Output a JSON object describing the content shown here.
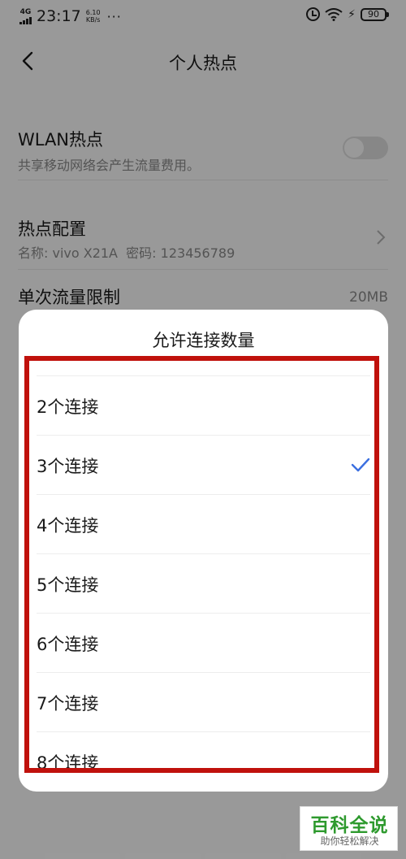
{
  "status_bar": {
    "network": "4G",
    "time": "23:17",
    "speed_value": "6.10",
    "speed_unit": "KB/s",
    "more": "···",
    "battery": "90"
  },
  "nav": {
    "title": "个人热点"
  },
  "settings": {
    "wlan_hotspot": {
      "title": "WLAN热点",
      "subtitle": "共享移动网络会产生流量费用。",
      "enabled": false
    },
    "hotspot_config": {
      "title": "热点配置",
      "subtitle": "名称: vivo X21A  密码: 123456789"
    },
    "data_limit": {
      "title": "单次流量限制",
      "value": "20MB"
    }
  },
  "dialog": {
    "title": "允许连接数量",
    "options": [
      {
        "label": "2个连接",
        "selected": false
      },
      {
        "label": "3个连接",
        "selected": true
      },
      {
        "label": "4个连接",
        "selected": false
      },
      {
        "label": "5个连接",
        "selected": false
      },
      {
        "label": "6个连接",
        "selected": false
      },
      {
        "label": "7个连接",
        "selected": false
      },
      {
        "label": "8个连接",
        "selected": false
      }
    ]
  },
  "colors": {
    "highlight": "#c0110c",
    "check": "#3b6fe0",
    "watermark_green": "#2e9a2e"
  },
  "watermark": {
    "title": "百科全说",
    "subtitle": "助你轻松解决"
  }
}
